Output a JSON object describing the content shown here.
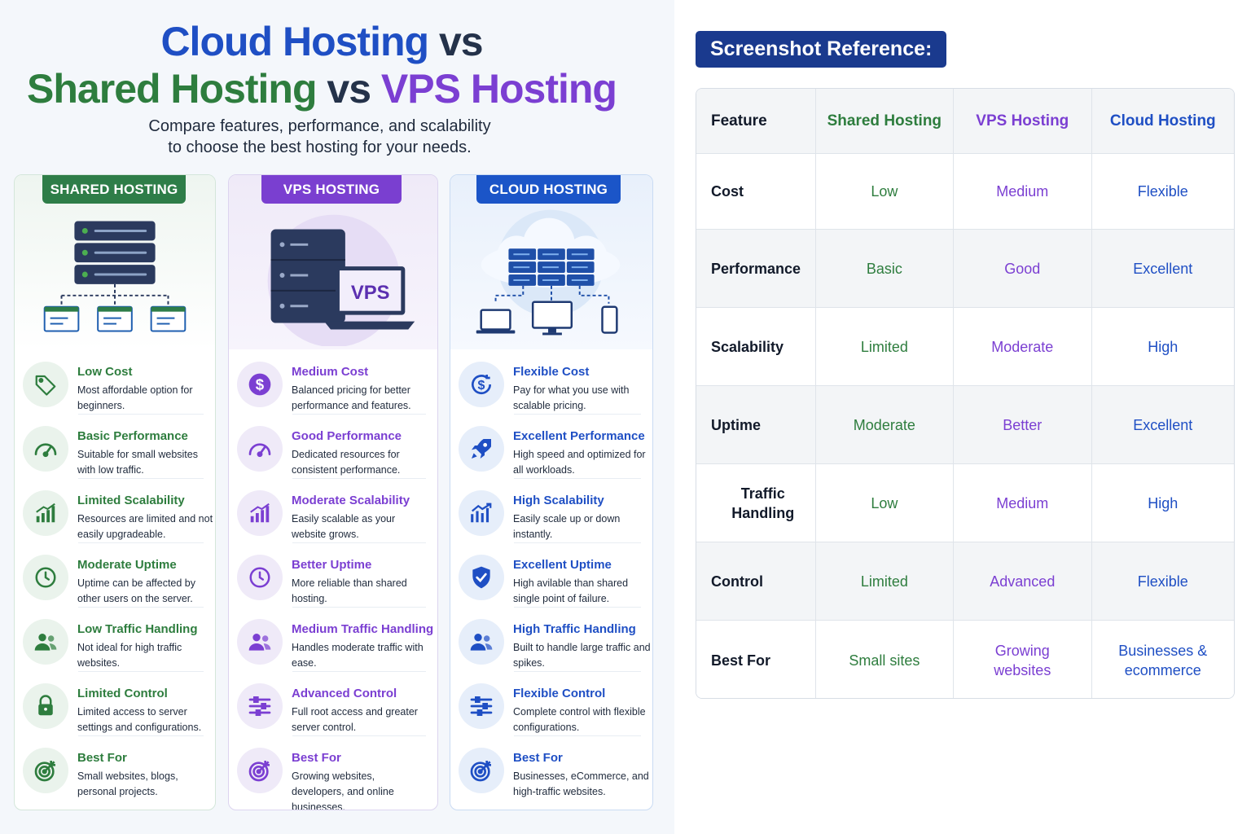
{
  "title": {
    "line1_a": "Cloud Hosting",
    "line1_b": " vs",
    "line2_a": "Shared Hosting",
    "line2_b": " vs ",
    "line2_c": "VPS Hosting"
  },
  "subtitle": {
    "line1": "Compare features, performance, and scalability",
    "line2": "to choose the best hosting for your needs."
  },
  "cards": {
    "shared": {
      "badge": "SHARED HOSTING",
      "accent": "#2e7d48",
      "features": [
        {
          "icon": "tag-icon",
          "title": "Low Cost",
          "desc": "Most affordable option for beginners."
        },
        {
          "icon": "gauge-icon",
          "title": "Basic Performance",
          "desc": "Suitable for small websites with low traffic."
        },
        {
          "icon": "bar-chart-icon",
          "title": "Limited Scalability",
          "desc": "Resources are limited and not easily upgradeable."
        },
        {
          "icon": "clock-icon",
          "title": "Moderate Uptime",
          "desc": "Uptime can be affected by other users on the server."
        },
        {
          "icon": "users-icon",
          "title": "Low Traffic Handling",
          "desc": "Not ideal for high traffic websites."
        },
        {
          "icon": "lock-icon",
          "title": "Limited Control",
          "desc": "Limited access to server settings and configurations."
        },
        {
          "icon": "target-icon",
          "title": "Best For",
          "desc": "Small websites, blogs, personal projects."
        }
      ]
    },
    "vps": {
      "badge": "VPS HOSTING",
      "illustration_label": "VPS",
      "accent": "#7a3fd0",
      "features": [
        {
          "icon": "dollar-icon",
          "title": "Medium Cost",
          "desc": "Balanced pricing for better performance and features."
        },
        {
          "icon": "gauge-icon",
          "title": "Good Performance",
          "desc": "Dedicated resources for consistent performance."
        },
        {
          "icon": "bar-chart-icon",
          "title": "Moderate Scalability",
          "desc": "Easily scalable as your website grows."
        },
        {
          "icon": "clock-icon",
          "title": "Better Uptime",
          "desc": "More reliable than shared hosting."
        },
        {
          "icon": "users-icon",
          "title": "Medium Traffic Handling",
          "desc": "Handles moderate traffic with ease."
        },
        {
          "icon": "sliders-icon",
          "title": "Advanced Control",
          "desc": "Full root access and greater server control."
        },
        {
          "icon": "target-icon",
          "title": "Best For",
          "desc": "Growing websites, developers, and online businesses."
        }
      ]
    },
    "cloud": {
      "badge": "CLOUD HOSTING",
      "accent": "#1b55c8",
      "features": [
        {
          "icon": "dollar-cycle-icon",
          "title": "Flexible Cost",
          "desc": "Pay for what you use with scalable pricing."
        },
        {
          "icon": "rocket-icon",
          "title": "Excellent Performance",
          "desc": "High speed and optimized for all workloads."
        },
        {
          "icon": "trend-chart-icon",
          "title": "High Scalability",
          "desc": "Easily scale up or down instantly."
        },
        {
          "icon": "shield-check-icon",
          "title": "Excellent Uptime",
          "desc": "High avilable than shared single point of failure."
        },
        {
          "icon": "users-icon",
          "title": "High Traffic Handling",
          "desc": "Built to handle large traffic and spikes."
        },
        {
          "icon": "sliders-icon",
          "title": "Flexible Control",
          "desc": "Complete control with flexible configurations."
        },
        {
          "icon": "target-icon",
          "title": "Best For",
          "desc": "Businesses, eCommerce, and high-traffic websites."
        }
      ]
    }
  },
  "reference": {
    "label": "Screenshot Reference:",
    "headers": [
      "Feature",
      "Shared Hosting",
      "VPS Hosting",
      "Cloud Hosting"
    ],
    "rows": [
      [
        "Cost",
        "Low",
        "Medium",
        "Flexible"
      ],
      [
        "Performance",
        "Basic",
        "Good",
        "Excellent"
      ],
      [
        "Scalability",
        "Limited",
        "Moderate",
        "High"
      ],
      [
        "Uptime",
        "Moderate",
        "Better",
        "Excellent"
      ],
      [
        "Traffic Handling",
        "Low",
        "Medium",
        "High"
      ],
      [
        "Control",
        "Limited",
        "Advanced",
        "Flexible"
      ],
      [
        "Best For",
        "Small sites",
        "Growing websites",
        "Businesses & ecommerce"
      ]
    ]
  },
  "colors": {
    "shared": "#2e7d3e",
    "vps": "#7b3fd2",
    "cloud": "#1f4fc4",
    "reference_label_bg": "#1a3a8e"
  }
}
